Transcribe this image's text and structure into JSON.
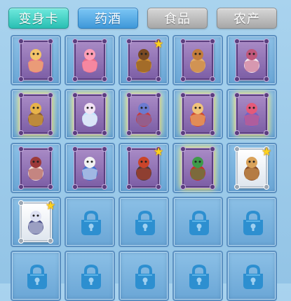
{
  "tabs": [
    {
      "label": "变身卡",
      "state": "active"
    },
    {
      "label": "药酒",
      "state": "blue"
    },
    {
      "label": "食品",
      "state": "grey"
    },
    {
      "label": "农产",
      "state": "grey"
    }
  ],
  "grid": {
    "rows": 5,
    "cols": 5,
    "slots": [
      {
        "type": "card",
        "icon": "pink-monster-transform-card",
        "star": false,
        "glow": false,
        "rare": false,
        "colors": [
          "#e0688a",
          "#f3c46a"
        ]
      },
      {
        "type": "card",
        "icon": "pink-flower-monster-transform-card",
        "star": false,
        "glow": false,
        "rare": false,
        "colors": [
          "#e86a86",
          "#ff9fb6"
        ]
      },
      {
        "type": "card",
        "icon": "golden-warrior-transform-card",
        "star": true,
        "glow": false,
        "rare": false,
        "colors": [
          "#d49432",
          "#7a4a23"
        ]
      },
      {
        "type": "card",
        "icon": "tan-beast-transform-card",
        "star": false,
        "glow": false,
        "rare": false,
        "colors": [
          "#e3b06f",
          "#c27c3c"
        ]
      },
      {
        "type": "card",
        "icon": "white-fairy-transform-card",
        "star": false,
        "glow": false,
        "rare": false,
        "colors": [
          "#f3e7ef",
          "#c0587c"
        ]
      },
      {
        "type": "card",
        "icon": "brown-gourd-monster-transform-card",
        "star": false,
        "glow": true,
        "rare": false,
        "colors": [
          "#8a5a2a",
          "#e7b34a"
        ]
      },
      {
        "type": "card",
        "icon": "blue-winged-fairy-transform-card",
        "star": false,
        "glow": true,
        "rare": false,
        "colors": [
          "#bfe6ff",
          "#f2e3f3"
        ]
      },
      {
        "type": "card",
        "icon": "red-bird-transform-card",
        "star": false,
        "glow": true,
        "rare": false,
        "colors": [
          "#c83a3a",
          "#6c7bd0"
        ]
      },
      {
        "type": "card",
        "icon": "red-haired-demon-transform-card",
        "star": false,
        "glow": true,
        "rare": false,
        "colors": [
          "#d04a2e",
          "#f0c37a"
        ]
      },
      {
        "type": "card",
        "icon": "purple-crab-transform-card",
        "star": false,
        "glow": true,
        "rare": false,
        "colors": [
          "#6f63c8",
          "#e45a7a"
        ]
      },
      {
        "type": "card",
        "icon": "dancer-lady-transform-card",
        "star": false,
        "glow": false,
        "rare": false,
        "colors": [
          "#f4e1d8",
          "#9c3a3a"
        ]
      },
      {
        "type": "card",
        "icon": "blue-bear-transform-card",
        "star": false,
        "glow": false,
        "rare": false,
        "colors": [
          "#3c6fd0",
          "#f2f2f2"
        ]
      },
      {
        "type": "card",
        "icon": "dark-armored-general-transform-card",
        "star": true,
        "glow": false,
        "rare": false,
        "colors": [
          "#4b3b3b",
          "#c9442a"
        ]
      },
      {
        "type": "card",
        "icon": "red-dragon-transform-card",
        "star": false,
        "glow": true,
        "rare": false,
        "colors": [
          "#c8302a",
          "#3e9a4a"
        ]
      },
      {
        "type": "card",
        "icon": "brown-beast-king-transform-card",
        "star": true,
        "glow": false,
        "rare": true,
        "colors": [
          "#8a4f2a",
          "#d9a25a"
        ]
      },
      {
        "type": "card",
        "icon": "purple-wolf-transform-card",
        "star": true,
        "glow": false,
        "rare": true,
        "colors": [
          "#4a4f88",
          "#dfe2f3"
        ]
      },
      {
        "type": "locked",
        "icon": "lock-icon"
      },
      {
        "type": "locked",
        "icon": "lock-icon"
      },
      {
        "type": "locked",
        "icon": "lock-icon"
      },
      {
        "type": "locked",
        "icon": "lock-icon"
      },
      {
        "type": "locked",
        "icon": "lock-icon"
      },
      {
        "type": "locked",
        "icon": "lock-icon"
      },
      {
        "type": "locked",
        "icon": "lock-icon"
      },
      {
        "type": "locked",
        "icon": "lock-icon"
      },
      {
        "type": "locked",
        "icon": "lock-icon"
      }
    ]
  },
  "colors": {
    "tab_active": "#2ec4b6",
    "tab_blue": "#4aa3e0",
    "tab_grey": "#b3b3b3",
    "lock": "#2d8fd0",
    "star": "#ffd21e",
    "card_frame": "#7d5fa6"
  }
}
